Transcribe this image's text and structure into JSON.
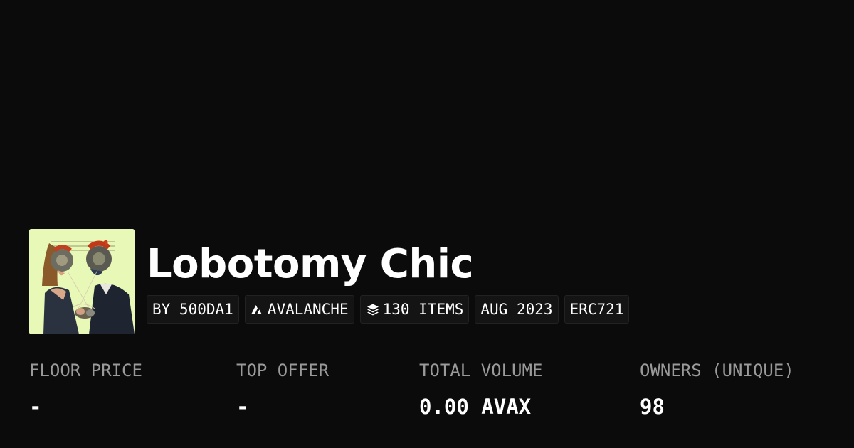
{
  "collection": {
    "name": "Lobotomy Chic",
    "image_alt": "collection-art"
  },
  "tags": [
    {
      "label": "BY 500DA1",
      "icon": ""
    },
    {
      "label": "AVALANCHE",
      "icon": "avalanche-icon"
    },
    {
      "label": "130 ITEMS",
      "icon": "layers-icon"
    },
    {
      "label": "AUG 2023",
      "icon": ""
    },
    {
      "label": "ERC721",
      "icon": ""
    }
  ],
  "stats": [
    {
      "label": "FLOOR PRICE",
      "value": "-"
    },
    {
      "label": "TOP OFFER",
      "value": "-"
    },
    {
      "label": "TOTAL VOLUME",
      "value": "0.00 AVAX"
    },
    {
      "label": "OWNERS (UNIQUE)",
      "value": "98"
    }
  ],
  "colors": {
    "background": "#0b0b0b",
    "text": "#ffffff",
    "muted": "#9a9a9a",
    "tag_bg": "#141414",
    "thumb_bg": "#e6f7b8"
  }
}
